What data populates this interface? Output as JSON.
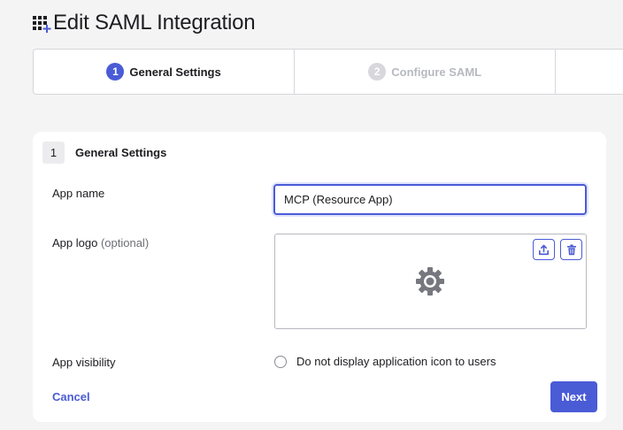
{
  "header": {
    "title": "Edit SAML Integration",
    "icon": "app-grid-add-icon"
  },
  "stepper": {
    "steps": [
      {
        "number": "1",
        "label": "General Settings",
        "state": "active"
      },
      {
        "number": "2",
        "label": "Configure SAML",
        "state": "inactive"
      },
      {
        "number": "",
        "label": "",
        "state": "inactive"
      }
    ]
  },
  "form": {
    "section_number": "1",
    "section_title": "General Settings",
    "app_name": {
      "label": "App name",
      "value": "MCP (Resource App)"
    },
    "app_logo": {
      "label": "App logo",
      "optional": "(optional)",
      "upload_icon": "upload-icon",
      "delete_icon": "trash-icon",
      "placeholder_icon": "gear-icon"
    },
    "app_visibility": {
      "label": "App visibility",
      "checkbox_label": "Do not display application icon to users",
      "checked": false
    },
    "cancel_label": "Cancel",
    "next_label": "Next"
  },
  "colors": {
    "accent": "#4a5bd6",
    "background": "#f4f4f4",
    "inactive_step": "#b7b9c0"
  }
}
